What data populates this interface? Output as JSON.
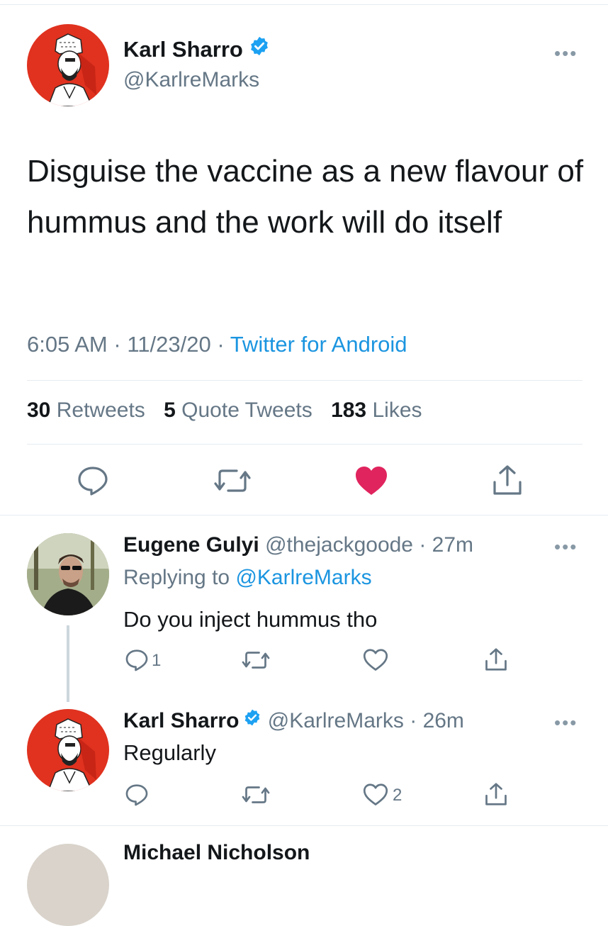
{
  "main_tweet": {
    "author_name": "Karl Sharro",
    "handle": "@KarlreMarks",
    "text": "Disguise the vaccine as a new flavour of hummus and the work will do itself",
    "time": "6:05 AM",
    "date": "11/23/20",
    "source": "Twitter for Android",
    "retweets_count": "30",
    "retweets_label": "Retweets",
    "quotes_count": "5",
    "quotes_label": "Quote Tweets",
    "likes_count": "183",
    "likes_label": "Likes",
    "liked": true
  },
  "replies": [
    {
      "author_name": "Eugene Gulyi",
      "handle": "@thejackgoode",
      "age": "27m",
      "replying_prefix": "Replying to",
      "replying_to": "@KarlreMarks",
      "text": "Do you inject hummus tho",
      "reply_count": "1",
      "like_count": ""
    },
    {
      "author_name": "Karl Sharro",
      "handle": "@KarlreMarks",
      "age": "26m",
      "text": "Regularly",
      "reply_count": "",
      "like_count": "2"
    }
  ],
  "next_reply_partial_name": "Michael Nicholson",
  "icons": {
    "more": "more-horizontal-icon",
    "verified": "verified-badge-icon",
    "reply": "reply-icon",
    "retweet": "retweet-icon",
    "like": "heart-icon",
    "share": "share-icon"
  },
  "colors": {
    "accent": "#1b95e0",
    "like_active": "#e0245e",
    "verified": "#1da1f2",
    "secondary_text": "#657786",
    "avatar_bg": "#e0321f"
  }
}
